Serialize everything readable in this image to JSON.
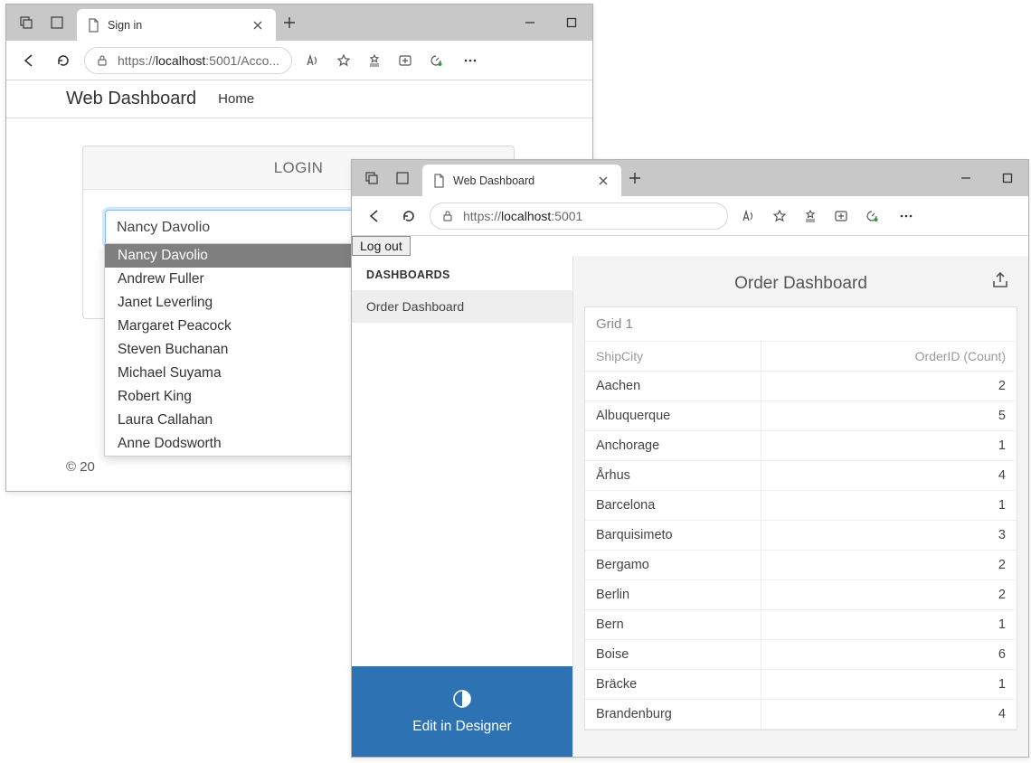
{
  "win1": {
    "tab_title": "Sign in",
    "url_display_prefix": "https://",
    "url_display_host": "localhost",
    "url_display_port": ":5001",
    "url_display_path": "/Acco...",
    "brand": "Web Dashboard",
    "nav_home": "Home",
    "login_title": "LOGIN",
    "login_value": "Nancy Davolio",
    "dropdown": [
      "Nancy Davolio",
      "Andrew Fuller",
      "Janet Leverling",
      "Margaret Peacock",
      "Steven Buchanan",
      "Michael Suyama",
      "Robert King",
      "Laura Callahan",
      "Anne Dodsworth"
    ],
    "footer": "© 20"
  },
  "win2": {
    "tab_title": "Web Dashboard",
    "url_display_prefix": "https://",
    "url_display_host": "localhost",
    "url_display_port": ":5001",
    "logout": "Log out",
    "sidebar_heading": "DASHBOARDS",
    "sidebar_item": "Order Dashboard",
    "edit_designer": "Edit in Designer",
    "dashboard_title": "Order Dashboard",
    "grid_title": "Grid 1",
    "grid_col1": "ShipCity",
    "grid_col2": "OrderID (Count)",
    "grid_rows": [
      {
        "city": "Aachen",
        "count": 2
      },
      {
        "city": "Albuquerque",
        "count": 5
      },
      {
        "city": "Anchorage",
        "count": 1
      },
      {
        "city": "Århus",
        "count": 4
      },
      {
        "city": "Barcelona",
        "count": 1
      },
      {
        "city": "Barquisimeto",
        "count": 3
      },
      {
        "city": "Bergamo",
        "count": 2
      },
      {
        "city": "Berlin",
        "count": 2
      },
      {
        "city": "Bern",
        "count": 1
      },
      {
        "city": "Boise",
        "count": 6
      },
      {
        "city": "Bräcke",
        "count": 1
      },
      {
        "city": "Brandenburg",
        "count": 4
      }
    ]
  }
}
